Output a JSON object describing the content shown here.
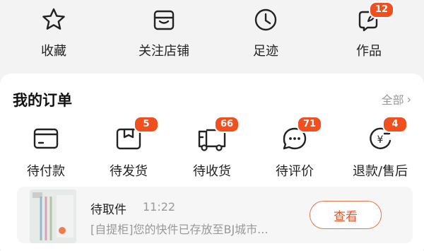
{
  "shortcuts": [
    {
      "label": "收藏",
      "icon": "star-icon"
    },
    {
      "label": "关注店铺",
      "icon": "store-icon"
    },
    {
      "label": "足迹",
      "icon": "clock-icon"
    },
    {
      "label": "作品",
      "icon": "edit-icon",
      "badge": "12"
    }
  ],
  "orders": {
    "title": "我的订单",
    "all_label": "全部",
    "items": [
      {
        "label": "待付款",
        "icon": "card-icon"
      },
      {
        "label": "待发货",
        "icon": "package-icon",
        "badge": "5"
      },
      {
        "label": "待收货",
        "icon": "truck-icon",
        "badge": "66"
      },
      {
        "label": "待评价",
        "icon": "chat-icon",
        "badge": "71"
      },
      {
        "label": "退款/售后",
        "icon": "refund-icon",
        "badge": "4"
      }
    ]
  },
  "pickup": {
    "title": "待取件",
    "time": "11:22",
    "description": "[自提柜]您的快件已存放至BJ城市...",
    "button_label": "查看"
  },
  "colors": {
    "accent": "#f04f1e",
    "button": "#e2582a"
  }
}
